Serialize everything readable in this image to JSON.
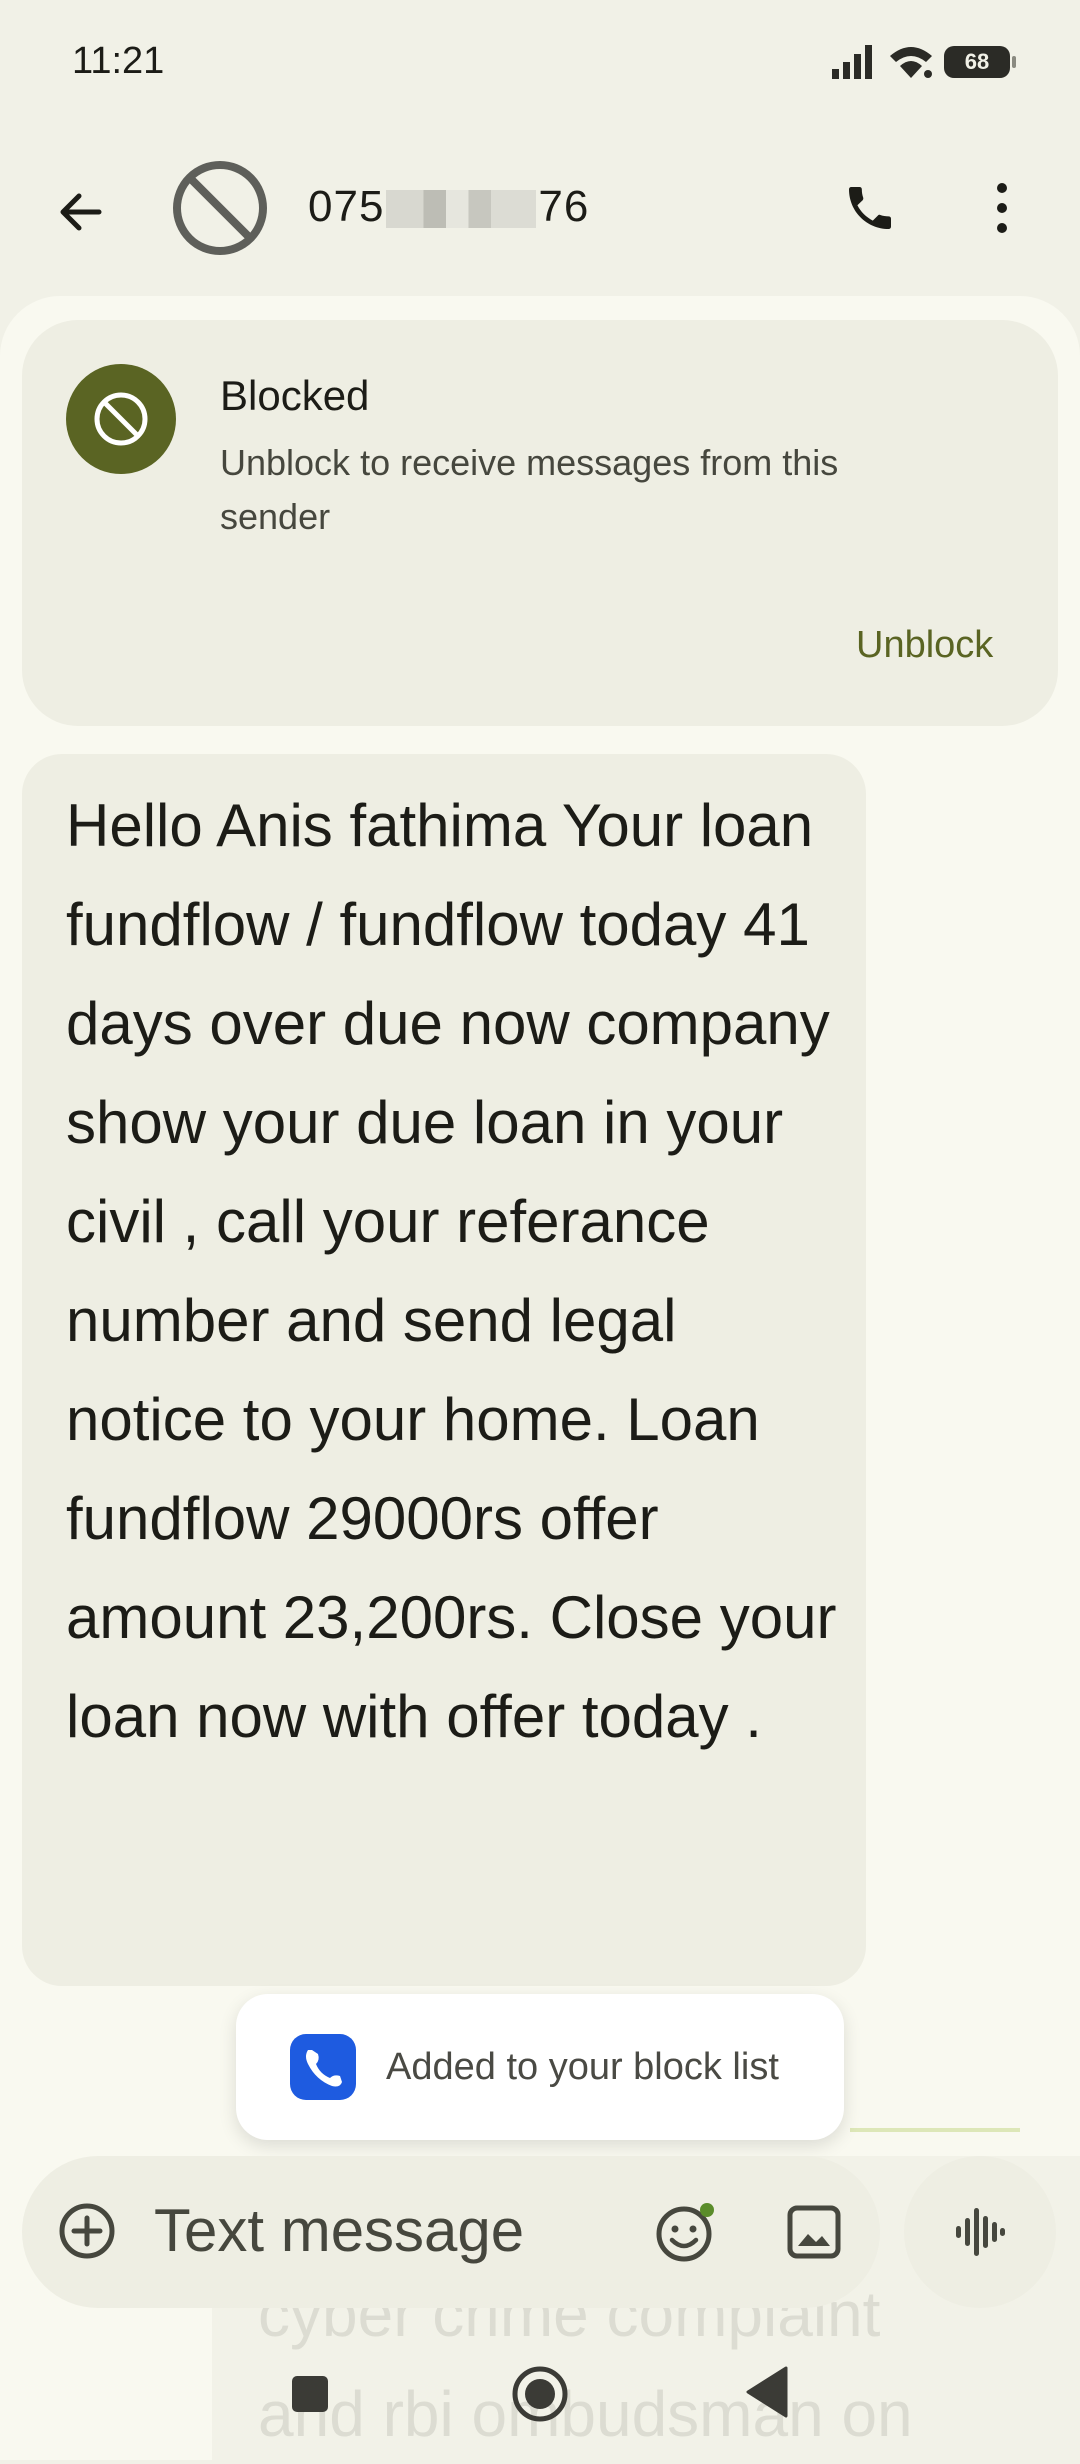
{
  "status_bar": {
    "time": "11:21",
    "battery": "68"
  },
  "app_bar": {
    "contact_prefix": "075",
    "contact_suffix": "76"
  },
  "blocked_banner": {
    "title": "Blocked",
    "description": "Unblock to receive messages from this sender",
    "unblock_label": "Unblock"
  },
  "message": {
    "text": "Hello Anis fathima Your loan fundflow / fundflow today 41 days over due now company show your due loan in your civil , call your referance number and send legal notice to your home. Loan fundflow 29000rs offer amount 23,200rs. Close your loan now with offer today ."
  },
  "snackbar": {
    "text": "Added to your block list"
  },
  "faded_message": {
    "line1": "cyber crime complaint",
    "line2": "and rbi ombudsman on"
  },
  "compose": {
    "placeholder": "Text message"
  },
  "colors": {
    "background": "#F1F1E7",
    "sheet": "#F9F9F0",
    "card": "#EEEEE3",
    "accent": "#5A6423",
    "text": "#1C1C17"
  },
  "icons": {
    "back": "arrow-left-icon",
    "avatar": "blocked-avatar-icon",
    "call": "phone-icon",
    "more": "more-vert-icon",
    "blocked": "block-icon",
    "add": "add-circle-icon",
    "emoji": "emoji-icon",
    "gallery": "image-icon",
    "voice": "voice-waveform-icon"
  }
}
